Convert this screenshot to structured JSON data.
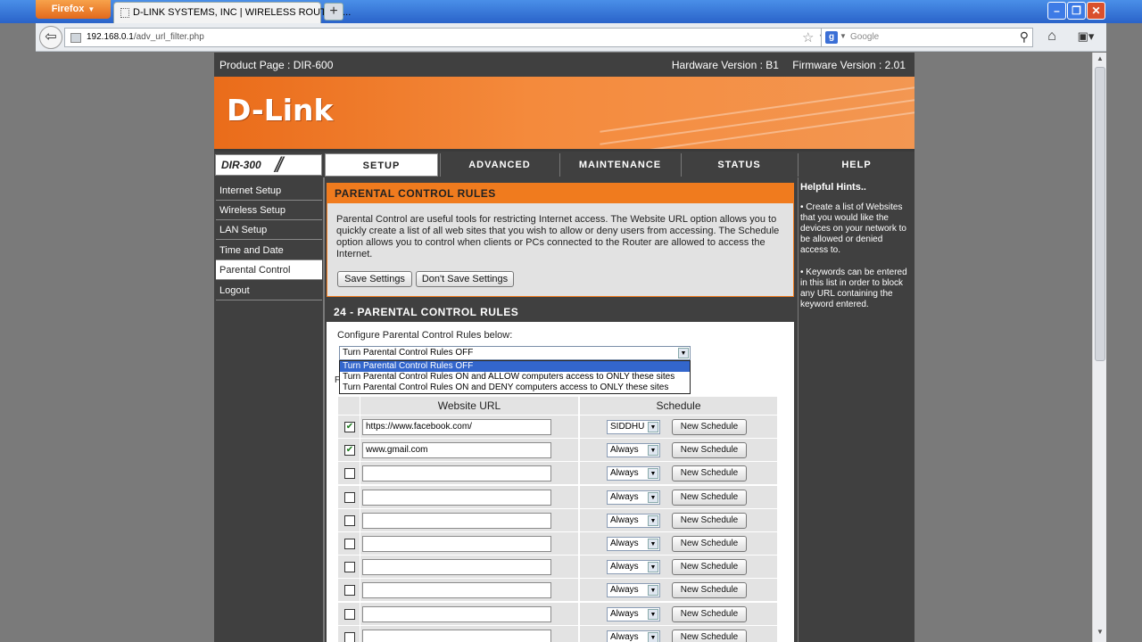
{
  "browser": {
    "app_button": "Firefox",
    "tab_title": "D-LINK SYSTEMS, INC | WIRELESS ROUTER ...",
    "url_host": "192.168.0.1",
    "url_path": "/adv_url_filter.php",
    "search_engine": "g",
    "search_placeholder": "Google"
  },
  "header": {
    "product_page": "Product Page :  DIR-600",
    "hardware_version": "Hardware Version : B1",
    "firmware_version": "Firmware Version : 2.01",
    "logo": "D-Link",
    "model": "DIR-300"
  },
  "nav_tabs": [
    "SETUP",
    "ADVANCED",
    "MAINTENANCE",
    "STATUS",
    "HELP"
  ],
  "sidebar": {
    "items": [
      "Internet Setup",
      "Wireless Setup",
      "LAN Setup",
      "Time and Date",
      "Parental Control",
      "Logout"
    ],
    "active": "Parental Control"
  },
  "rules_section": {
    "title": "PARENTAL CONTROL RULES",
    "description": "Parental Control are useful tools for restricting Internet access. The Website URL option allows you to quickly create a list of all web sites that you wish to allow or deny users from accessing. The Schedule option allows you to control when clients or PCs connected to the Router are allowed to access the Internet.",
    "save_label": "Save Settings",
    "dont_save_label": "Don't Save Settings"
  },
  "pc_section": {
    "title": "24 - PARENTAL CONTROL RULES",
    "configure_label": "Configure Parental Control Rules below:",
    "selected_option": "Turn Parental Control Rules OFF",
    "options": [
      "Turn Parental Control Rules OFF",
      "Turn Parental Control Rules ON and ALLOW computers access to ONLY these sites",
      "Turn Parental Control Rules ON and DENY computers access to ONLY these sites"
    ],
    "hidden_label": "F",
    "col_url": "Website URL",
    "col_schedule": "Schedule",
    "new_schedule_label": "New Schedule",
    "rows": [
      {
        "checked": true,
        "url": "https://www.facebook.com/",
        "schedule": "SIDDHU"
      },
      {
        "checked": true,
        "url": "www.gmail.com",
        "schedule": "Always"
      },
      {
        "checked": false,
        "url": "",
        "schedule": "Always"
      },
      {
        "checked": false,
        "url": "",
        "schedule": "Always"
      },
      {
        "checked": false,
        "url": "",
        "schedule": "Always"
      },
      {
        "checked": false,
        "url": "",
        "schedule": "Always"
      },
      {
        "checked": false,
        "url": "",
        "schedule": "Always"
      },
      {
        "checked": false,
        "url": "",
        "schedule": "Always"
      },
      {
        "checked": false,
        "url": "",
        "schedule": "Always"
      },
      {
        "checked": false,
        "url": "",
        "schedule": "Always"
      }
    ]
  },
  "help": {
    "title": "Helpful Hints..",
    "hints": [
      "• Create a list of Websites that you would like the devices on your network to be allowed or denied access to.",
      "• Keywords can be entered in this list in order to block any URL containing the keyword entered."
    ]
  },
  "colors": {
    "accent": "#f07b1e",
    "dark_bg": "#404040",
    "selection": "#3366cc"
  }
}
